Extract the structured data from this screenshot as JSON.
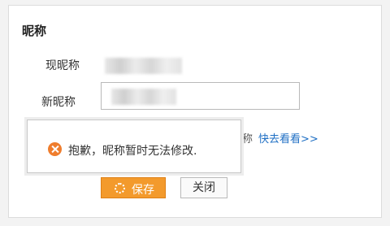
{
  "section": {
    "title": "昵称"
  },
  "form": {
    "current_label": "现昵称",
    "new_label": "新昵称"
  },
  "hint": {
    "tail_text": "称",
    "link_text": "快去看看>>"
  },
  "toast": {
    "icon": "error-x-icon",
    "message": "抱歉，昵称暂时无法修改."
  },
  "buttons": {
    "save_label": "保存",
    "close_label": "关闭"
  },
  "colors": {
    "save_button": "#f39a2c",
    "link": "#1f6fc4",
    "error_icon": "#ef7d2d"
  }
}
